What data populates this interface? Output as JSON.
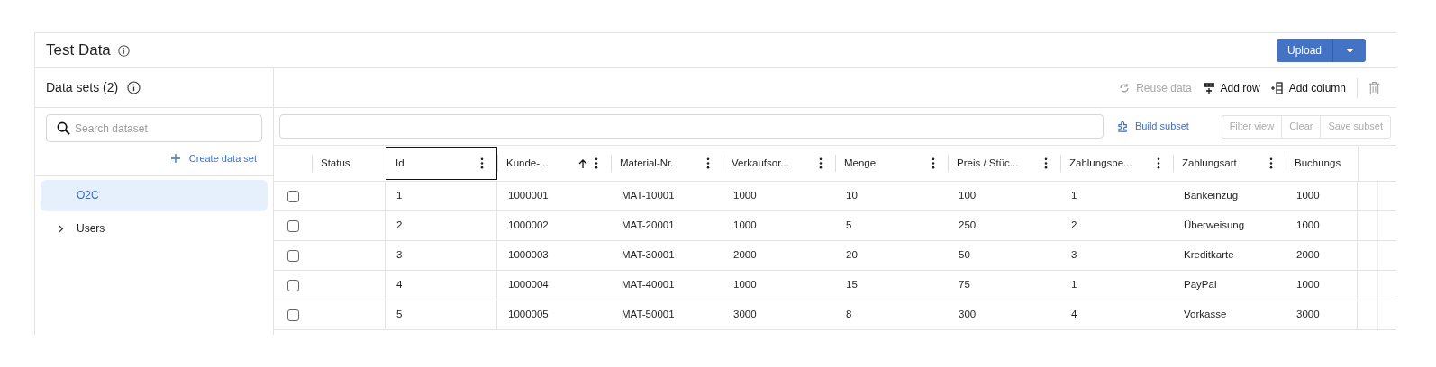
{
  "header": {
    "title": "Test Data",
    "upload_button": "Upload"
  },
  "sidebar": {
    "title": "Data sets (2)",
    "search": {
      "placeholder": "Search dataset"
    },
    "create_link": "Create data set",
    "items": [
      {
        "label": "O2C",
        "kind": "dataset",
        "selected": true
      },
      {
        "label": "Users",
        "kind": "folder",
        "selected": false,
        "expanded": false
      }
    ]
  },
  "toolbar": [
    {
      "label": "Reuse data",
      "kind": "reuse",
      "disabled": true
    },
    {
      "label": "Add row",
      "kind": "row",
      "disabled": false
    },
    {
      "label": "Add column",
      "kind": "column",
      "disabled": false
    }
  ],
  "filter": {
    "build_subset": "Build subset",
    "buttons": [
      {
        "label": "Filter view",
        "disabled": true
      },
      {
        "label": "Clear",
        "disabled": true
      },
      {
        "label": "Save subset",
        "disabled": true
      }
    ]
  },
  "table": {
    "columns": [
      {
        "label": "Status",
        "menu": false,
        "sorted": false,
        "focused": false
      },
      {
        "label": "Id",
        "menu": true,
        "sorted": false,
        "focused": true
      },
      {
        "label": "Kunde-...",
        "menu": true,
        "sorted": true,
        "focused": false
      },
      {
        "label": "Material-Nr.",
        "menu": true,
        "sorted": false,
        "focused": false
      },
      {
        "label": "Verkaufsor...",
        "menu": true,
        "sorted": false,
        "focused": false
      },
      {
        "label": "Menge",
        "menu": true,
        "sorted": false,
        "focused": false
      },
      {
        "label": "Preis / Stüc...",
        "menu": true,
        "sorted": false,
        "focused": false
      },
      {
        "label": "Zahlungsbe...",
        "menu": true,
        "sorted": false,
        "focused": false
      },
      {
        "label": "Zahlungsart",
        "menu": true,
        "sorted": false,
        "focused": false
      },
      {
        "label": "Buchungs",
        "menu": false,
        "sorted": false,
        "focused": false
      }
    ],
    "rows": [
      {
        "checked": false,
        "cells": [
          "",
          "1",
          "1000001",
          "MAT-10001",
          "1000",
          "10",
          "100",
          "1",
          "Bankeinzug",
          "1000"
        ]
      },
      {
        "checked": false,
        "cells": [
          "",
          "2",
          "1000002",
          "MAT-20001",
          "1000",
          "5",
          "250",
          "2",
          "Überweisung",
          "1000"
        ]
      },
      {
        "checked": false,
        "cells": [
          "",
          "3",
          "1000003",
          "MAT-30001",
          "2000",
          "20",
          "50",
          "3",
          "Kreditkarte",
          "2000"
        ]
      },
      {
        "checked": false,
        "cells": [
          "",
          "4",
          "1000004",
          "MAT-40001",
          "1000",
          "15",
          "75",
          "1",
          "PayPal",
          "1000"
        ]
      },
      {
        "checked": false,
        "cells": [
          "",
          "5",
          "1000005",
          "MAT-50001",
          "3000",
          "8",
          "300",
          "4",
          "Vorkasse",
          "3000"
        ]
      }
    ]
  }
}
